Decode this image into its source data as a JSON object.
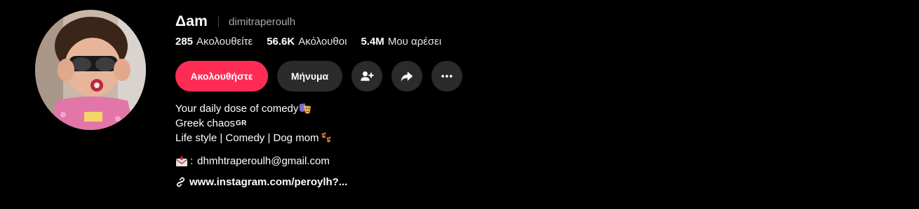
{
  "profile": {
    "display_name": "Δam",
    "username": "dimitraperoulh"
  },
  "stats": {
    "following_count": "285",
    "following_label": "Ακολουθείτε",
    "followers_count": "56.6K",
    "followers_label": "Ακόλουθοι",
    "likes_count": "5.4M",
    "likes_label": "Μου αρέσει"
  },
  "actions": {
    "follow_label": "Ακολουθήστε",
    "message_label": "Μήνυμα",
    "add_friend_icon": "person-add-icon",
    "share_icon": "share-arrow-icon",
    "more_icon": "more-dots-icon"
  },
  "bio": {
    "line1": "Your daily dose of comedy",
    "line1_emoji": "performing-arts-icon",
    "line2": "Greek chaos",
    "line2_flag": "GR",
    "line3": "Life style | Comedy | Dog mom",
    "line3_emoji": "paw-prints-icon"
  },
  "contact": {
    "mail_icon": "incoming-envelope-icon",
    "separator": ":",
    "email": "dhmhtraperoulh@gmail.com"
  },
  "link": {
    "icon": "link-icon",
    "text": "www.instagram.com/peroylh?..."
  },
  "colors": {
    "background": "#000000",
    "accent": "#fe2c55",
    "button_dark": "#2b2b2b",
    "muted_text": "#a8a8a8"
  }
}
